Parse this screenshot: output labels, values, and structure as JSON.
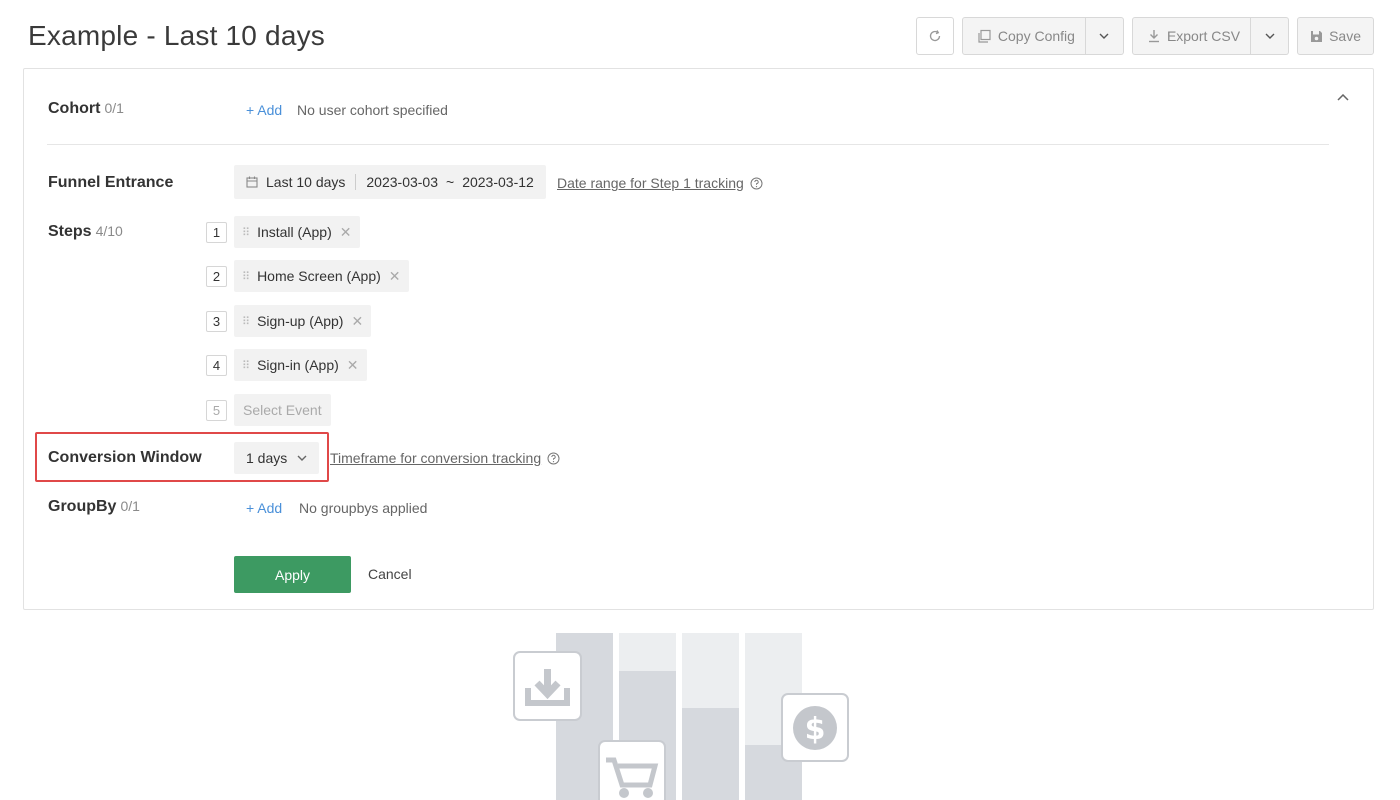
{
  "page": {
    "title": "Example - Last 10 days"
  },
  "toolbar": {
    "copy_label": "Copy Config",
    "export_label": "Export CSV",
    "save_label": "Save"
  },
  "cohort": {
    "label": "Cohort",
    "count": "0/1",
    "add_label": "+ Add",
    "empty_text": "No user cohort specified"
  },
  "funnel_entrance": {
    "label": "Funnel Entrance",
    "range_label": "Last 10 days",
    "range_start": "2023-03-03",
    "range_separator": "~",
    "range_end": "2023-03-12",
    "help_link": "Date range for Step 1 tracking"
  },
  "steps": {
    "label": "Steps",
    "count": "4/10",
    "items": [
      {
        "number": "1",
        "name": "Install (App)"
      },
      {
        "number": "2",
        "name": "Home Screen (App)"
      },
      {
        "number": "3",
        "name": "Sign-up (App)"
      },
      {
        "number": "4",
        "name": "Sign-in (App)"
      }
    ],
    "next": {
      "number": "5",
      "placeholder": "Select Event"
    }
  },
  "conversion_window": {
    "label": "Conversion Window",
    "value": "1 days",
    "help_link": "Timeframe for conversion tracking"
  },
  "groupby": {
    "label": "GroupBy",
    "count": "0/1",
    "add_label": "+ Add",
    "empty_text": "No groupbys applied"
  },
  "actions": {
    "apply_label": "Apply",
    "cancel_label": "Cancel"
  },
  "colors": {
    "accent": "#4a90d9",
    "apply": "#3d9a62",
    "highlight": "#e04848"
  }
}
